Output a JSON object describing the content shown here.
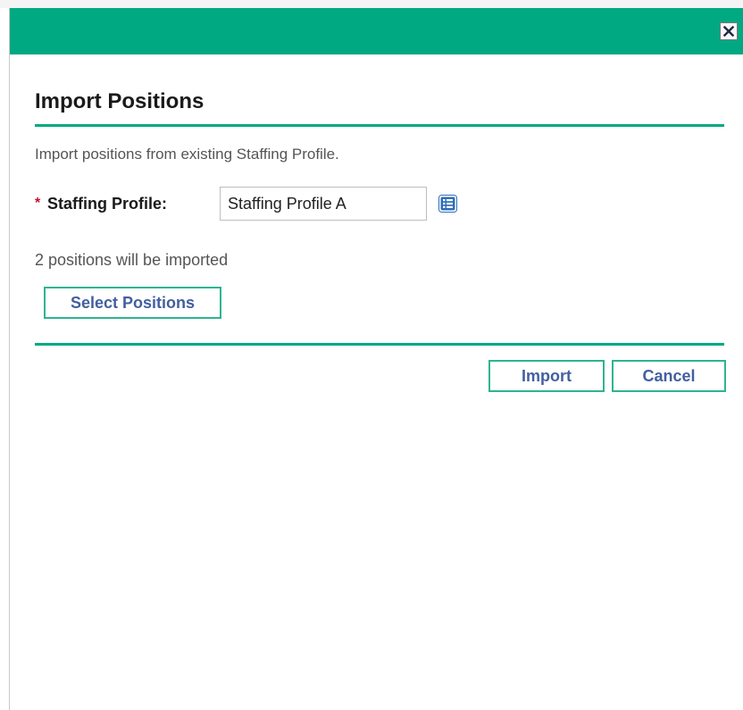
{
  "dialog": {
    "title": "Import Positions",
    "description": "Import positions from existing Staffing Profile.",
    "close_icon": "close-icon"
  },
  "form": {
    "required_marker": "*",
    "staffing_profile_label": "Staffing Profile:",
    "staffing_profile_value": "Staffing Profile A",
    "picker_icon": "list-picker-icon"
  },
  "status": {
    "positions_count_text": "2 positions will be imported"
  },
  "buttons": {
    "select_positions": "Select Positions",
    "import": "Import",
    "cancel": "Cancel"
  },
  "colors": {
    "accent": "#01a982",
    "button_text": "#425fa0",
    "required": "#c8102e",
    "icon_blue": "#2f6fb8"
  }
}
